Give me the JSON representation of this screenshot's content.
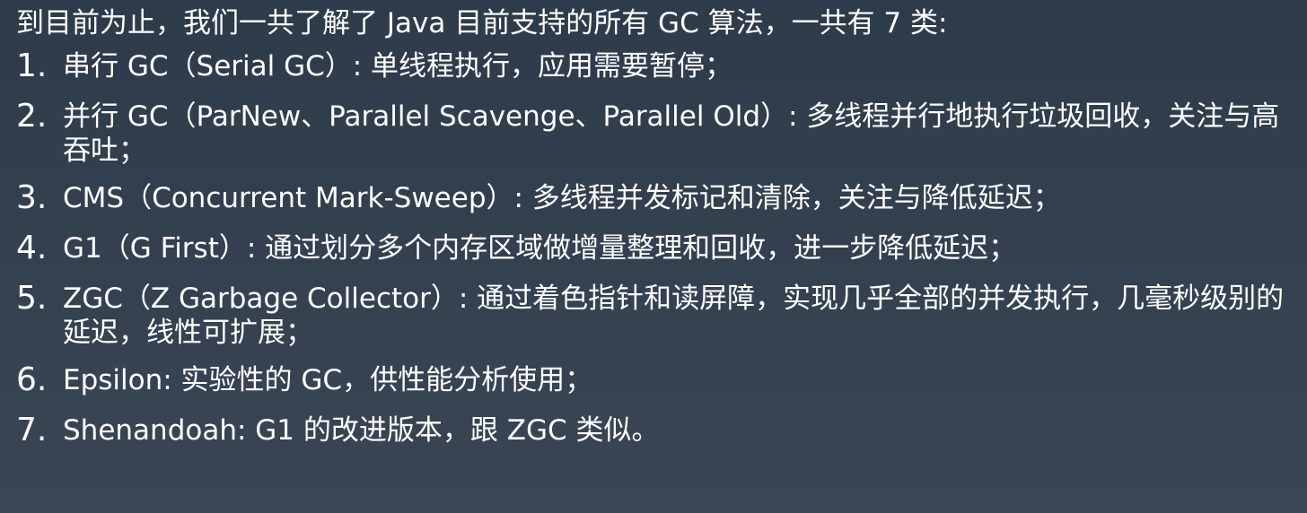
{
  "slide": {
    "intro": "到目前为止，我们一共了解了 Java 目前支持的所有 GC 算法，一共有 7 类:",
    "items": [
      {
        "number": "1.",
        "text": "串行 GC（Serial GC）: 单线程执行，应用需要暂停；"
      },
      {
        "number": "2.",
        "text": "并行 GC（ParNew、Parallel Scavenge、Parallel Old）: 多线程并行地执行垃圾回收，关注与高吞吐；"
      },
      {
        "number": "3.",
        "text": "CMS（Concurrent Mark-Sweep）: 多线程并发标记和清除，关注与降低延迟；"
      },
      {
        "number": "4.",
        "text": "G1（G First）: 通过划分多个内存区域做增量整理和回收，进一步降低延迟；"
      },
      {
        "number": "5.",
        "text": "ZGC（Z Garbage Collector）: 通过着色指针和读屏障，实现几乎全部的并发执行，几毫秒级别的延迟，线性可扩展；"
      },
      {
        "number": "6.",
        "text": "Epsilon: 实验性的 GC，供性能分析使用；"
      },
      {
        "number": "7.",
        "text": "Shenandoah: G1 的改进版本，跟 ZGC 类似。"
      }
    ]
  }
}
